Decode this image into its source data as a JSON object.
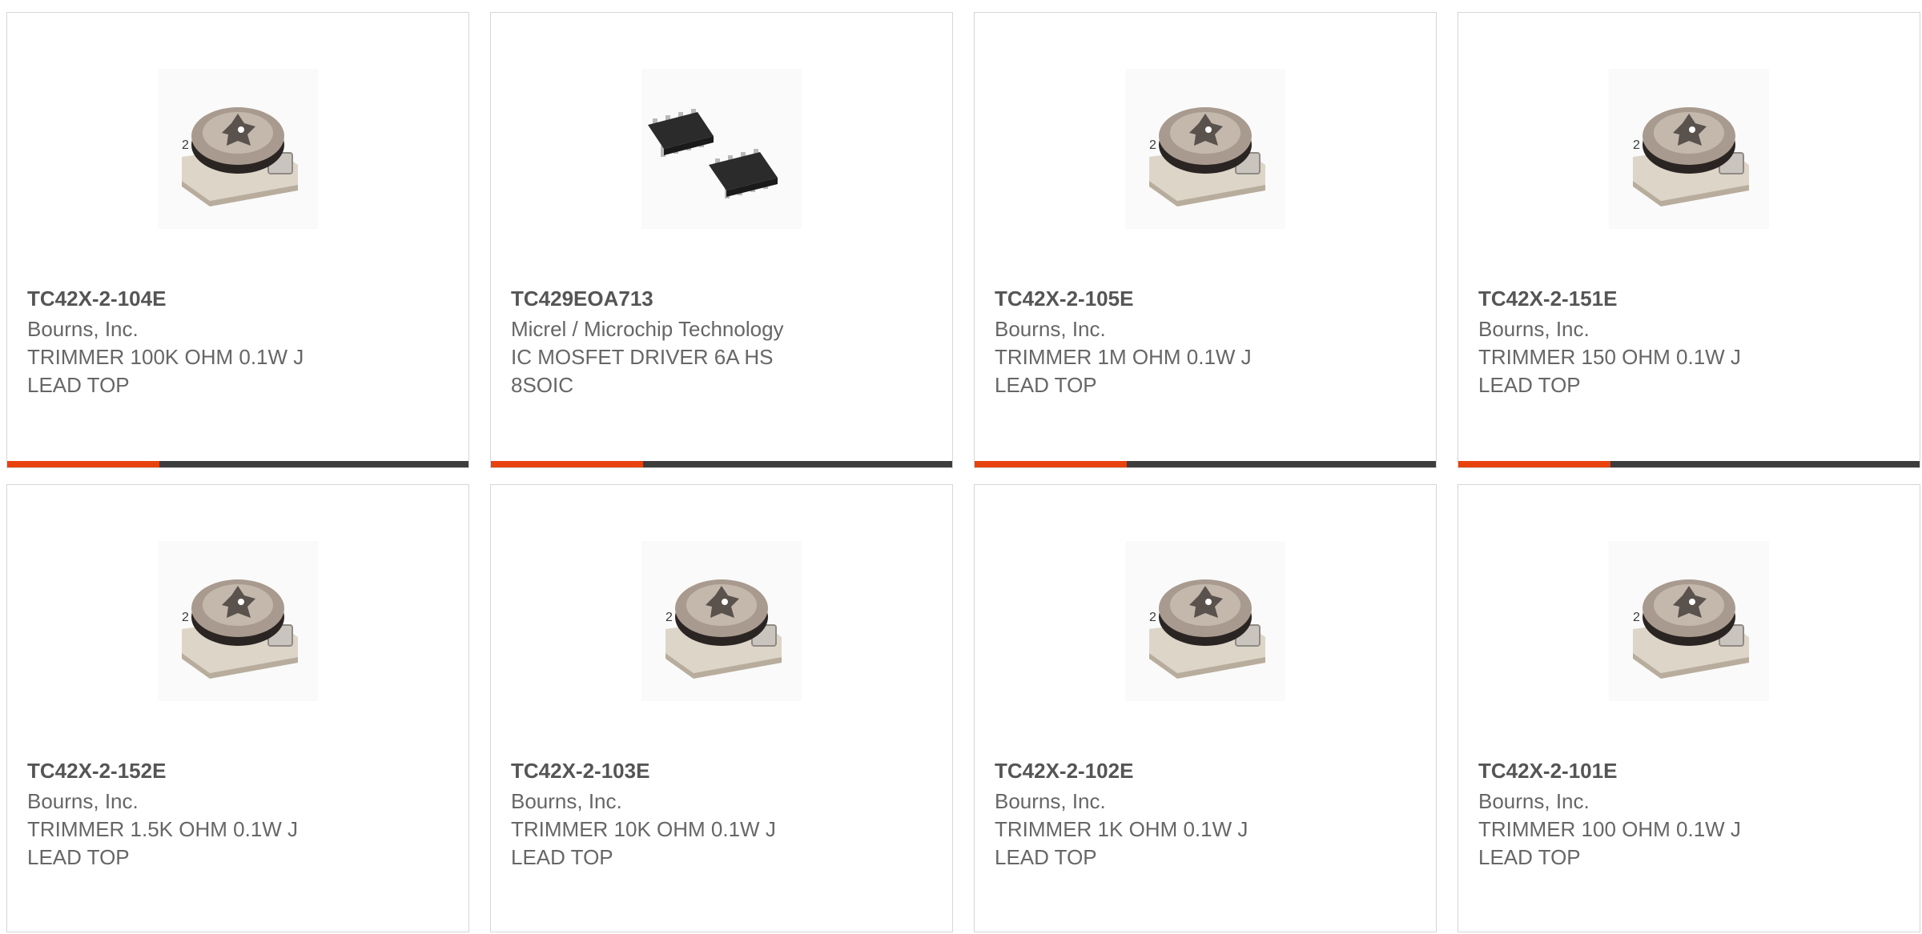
{
  "colors": {
    "accent": "#e8430e",
    "track": "#3d3d3d",
    "border": "#d6d6d6",
    "text": "#666666"
  },
  "cards": [
    {
      "part_number": "TC42X-2-104E",
      "manufacturer": "Bourns, Inc.",
      "description": "TRIMMER 100K OHM 0.1W J\nLEAD TOP",
      "image": "trimmer-icon",
      "progress": 0.33
    },
    {
      "part_number": "TC429EOA713",
      "manufacturer": "Micrel / Microchip Technology",
      "description": "IC MOSFET DRIVER 6A HS\n8SOIC",
      "image": "soic-chip-icon",
      "progress": 0.33
    },
    {
      "part_number": "TC42X-2-105E",
      "manufacturer": "Bourns, Inc.",
      "description": "TRIMMER 1M OHM 0.1W J\nLEAD TOP",
      "image": "trimmer-icon",
      "progress": 0.33
    },
    {
      "part_number": "TC42X-2-151E",
      "manufacturer": "Bourns, Inc.",
      "description": "TRIMMER 150 OHM 0.1W J\nLEAD TOP",
      "image": "trimmer-icon",
      "progress": 0.33
    },
    {
      "part_number": "TC42X-2-152E",
      "manufacturer": "Bourns, Inc.",
      "description": "TRIMMER 1.5K OHM 0.1W J\nLEAD TOP",
      "image": "trimmer-icon"
    },
    {
      "part_number": "TC42X-2-103E",
      "manufacturer": "Bourns, Inc.",
      "description": "TRIMMER 10K OHM 0.1W J\nLEAD TOP",
      "image": "trimmer-icon"
    },
    {
      "part_number": "TC42X-2-102E",
      "manufacturer": "Bourns, Inc.",
      "description": "TRIMMER 1K OHM 0.1W J\nLEAD TOP",
      "image": "trimmer-icon"
    },
    {
      "part_number": "TC42X-2-101E",
      "manufacturer": "Bourns, Inc.",
      "description": "TRIMMER 100 OHM 0.1W J\nLEAD TOP",
      "image": "trimmer-icon"
    }
  ]
}
